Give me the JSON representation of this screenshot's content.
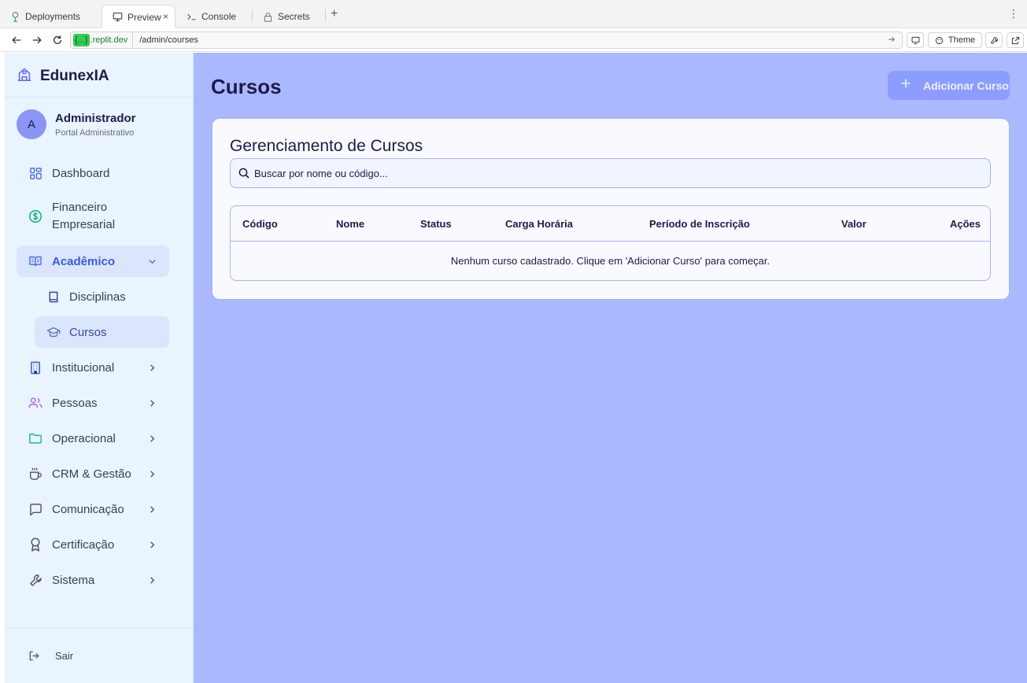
{
  "browser": {
    "tabs": [
      {
        "label": "Deployments",
        "icon": "deployments-icon"
      },
      {
        "label": "Preview",
        "icon": "monitor-icon",
        "active": true
      },
      {
        "label": "Console",
        "icon": "terminal-icon"
      },
      {
        "label": "Secrets",
        "icon": "lock-icon"
      }
    ],
    "close_glyph": "×",
    "new_tab_glyph": "+",
    "menu_glyph": "⋮",
    "url_host_blob": "{...}",
    "url_host": ".replit.dev",
    "url_path": "/admin/courses",
    "theme_label": "Theme"
  },
  "sidebar": {
    "brand": "EdunexIA",
    "user": {
      "initial": "A",
      "name": "Administrador",
      "role": "Portal Administrativo"
    },
    "items": [
      {
        "label": "Dashboard",
        "icon": "dashboard-icon"
      },
      {
        "label": "Financeiro\nEmpresarial",
        "icon": "dollar-circle-icon"
      },
      {
        "label": "Acadêmico",
        "icon": "book-open-icon",
        "expanded": true
      },
      {
        "label": "Institucional",
        "icon": "building-icon"
      },
      {
        "label": "Pessoas",
        "icon": "users-icon"
      },
      {
        "label": "Operacional",
        "icon": "folder-icon"
      },
      {
        "label": "CRM & Gestão",
        "icon": "coffee-icon"
      },
      {
        "label": "Comunicação",
        "icon": "message-icon"
      },
      {
        "label": "Certificação",
        "icon": "award-icon"
      },
      {
        "label": "Sistema",
        "icon": "wrench-icon"
      }
    ],
    "subitems": [
      {
        "label": "Disciplinas",
        "icon": "book-icon"
      },
      {
        "label": "Cursos",
        "icon": "graduation-cap-icon",
        "active": true
      }
    ],
    "logout_label": "Sair"
  },
  "main": {
    "title": "Cursos",
    "add_button": "Adicionar Curso",
    "card_title": "Gerenciamento de Cursos",
    "search_placeholder": "Buscar por nome ou código...",
    "columns": [
      "Código",
      "Nome",
      "Status",
      "Carga Horária",
      "Período de Inscrição",
      "Valor",
      "Ações"
    ],
    "empty_message": "Nenhum curso cadastrado. Clique em 'Adicionar Curso' para começar."
  },
  "colors": {
    "sidebar_bg": "#e9f4ff",
    "main_bg": "#aab8ff",
    "accent": "#3b5bdb",
    "button_bg": "#8c9cff"
  }
}
